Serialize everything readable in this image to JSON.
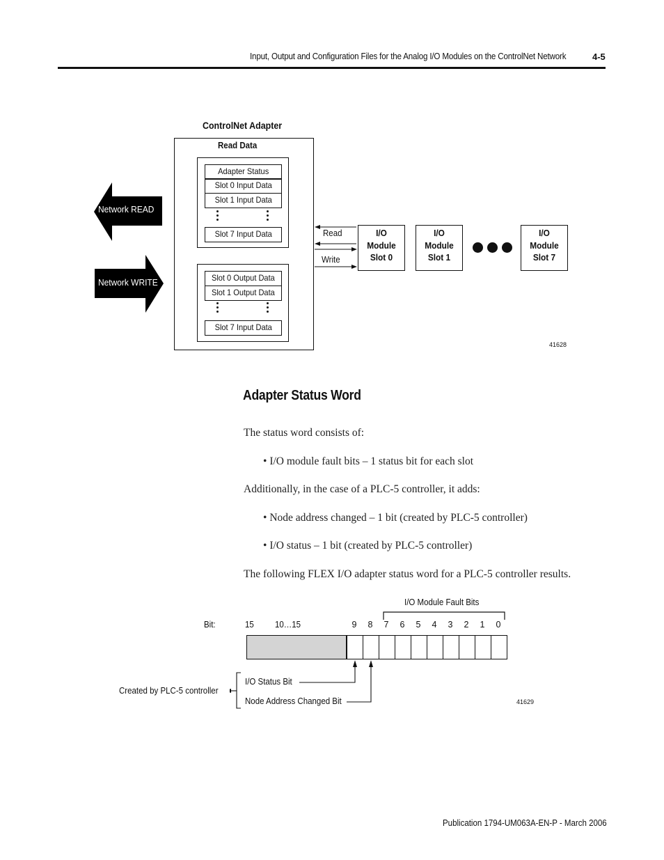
{
  "header": {
    "title": "Input, Output and Configuration Files for the Analog I/O Modules on the ControlNet Network",
    "page_number": "4-5"
  },
  "figure1": {
    "title": "ControlNet Adapter",
    "read_data_label": "Read Data",
    "read_rows": [
      "Adapter Status",
      "Slot 0 Input Data",
      "Slot 1 Input Data",
      "Slot 7 Input Data"
    ],
    "write_rows": [
      "Slot 0 Output Data",
      "Slot 1 Output Data",
      "Slot 7 Input Data"
    ],
    "network_read_label": "Network READ",
    "network_write_label": "Network WRITE",
    "read_label": "Read",
    "write_label": "Write",
    "modules": [
      {
        "line1": "I/O",
        "line2": "Module",
        "line3": "Slot 0"
      },
      {
        "line1": "I/O",
        "line2": "Module",
        "line3": "Slot 1"
      },
      {
        "line1": "I/O",
        "line2": "Module",
        "line3": "Slot 7"
      }
    ],
    "figure_number": "41628"
  },
  "section": {
    "heading": "Adapter Status Word",
    "intro": "The status word consists of:",
    "bullets1": [
      "I/O module fault bits – 1 status bit for each slot"
    ],
    "additional": "Additionally, in the case of a PLC-5 controller, it adds:",
    "bullets2": [
      "Node address changed – 1 bit (created by PLC-5 controller)",
      "I/O status – 1 bit (created by PLC-5 controller)"
    ],
    "result": "The following FLEX I/O adapter status word for a PLC-5 controller results."
  },
  "figure2": {
    "bit_label": "Bit:",
    "bit_15": "15",
    "bit_range": "10…15",
    "bits": [
      "9",
      "8",
      "7",
      "6",
      "5",
      "4",
      "3",
      "2",
      "1",
      "0"
    ],
    "fault_bits_label": "I/O Module Fault Bits",
    "io_status_label": "I/O Status Bit",
    "node_address_label": "Node Address Changed Bit",
    "created_by_label": "Created by PLC-5 controller",
    "figure_number": "41629"
  },
  "footer": {
    "publication": "Publication 1794-UM063A-EN-P - March 2006"
  }
}
